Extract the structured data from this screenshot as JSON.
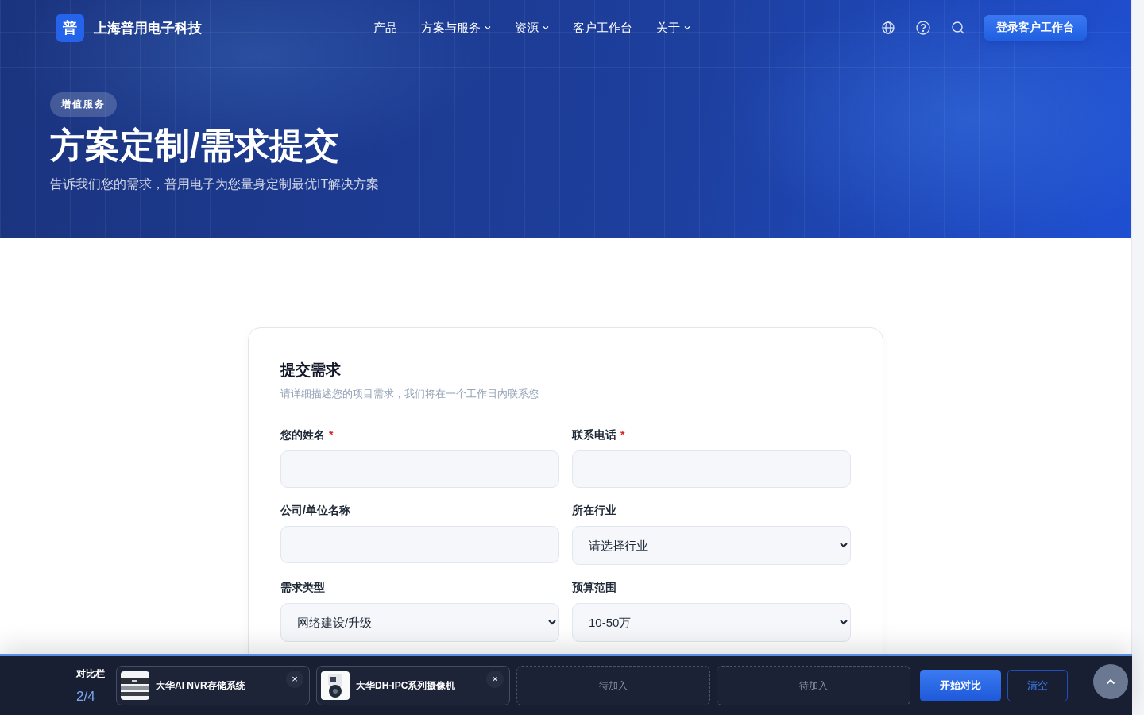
{
  "header": {
    "logo_mark": "普",
    "brand": "上海普用电子科技",
    "nav": [
      {
        "label": "产品",
        "dropdown": false
      },
      {
        "label": "方案与服务",
        "dropdown": true
      },
      {
        "label": "资源",
        "dropdown": true
      },
      {
        "label": "客户工作台",
        "dropdown": false
      },
      {
        "label": "关于",
        "dropdown": true
      }
    ],
    "login_button": "登录客户工作台"
  },
  "hero": {
    "badge": "增值服务",
    "title": "方案定制/需求提交",
    "subtitle": "告诉我们您的需求，普用电子为您量身定制最优IT解决方案"
  },
  "form": {
    "title": "提交需求",
    "subtitle": "请详细描述您的项目需求，我们将在一个工作日内联系您",
    "fields": [
      {
        "kind": "text",
        "label": "您的姓名",
        "asterisk": "*"
      },
      {
        "kind": "text",
        "label": "联系电话",
        "asterisk": "*"
      },
      {
        "kind": "text",
        "label": "公司/单位名称"
      },
      {
        "kind": "select",
        "label": "所在行业",
        "value": "请选择行业"
      },
      {
        "kind": "select",
        "label": "需求类型",
        "value": "网络建设/升级"
      },
      {
        "kind": "select",
        "label": "预算范围",
        "value": "10-50万"
      }
    ]
  },
  "compare_bar": {
    "title": "对比栏",
    "count": "2/4",
    "slots": [
      {
        "kind": "product",
        "name": "大华AI NVR存储系统",
        "remove": "×"
      },
      {
        "kind": "product",
        "name": "大华DH-IPC系列摄像机",
        "remove": "×"
      },
      {
        "kind": "empty",
        "label": "待加入"
      },
      {
        "kind": "empty",
        "label": "待加入"
      }
    ],
    "start_button": "开始对比",
    "clear_button": "清空"
  }
}
